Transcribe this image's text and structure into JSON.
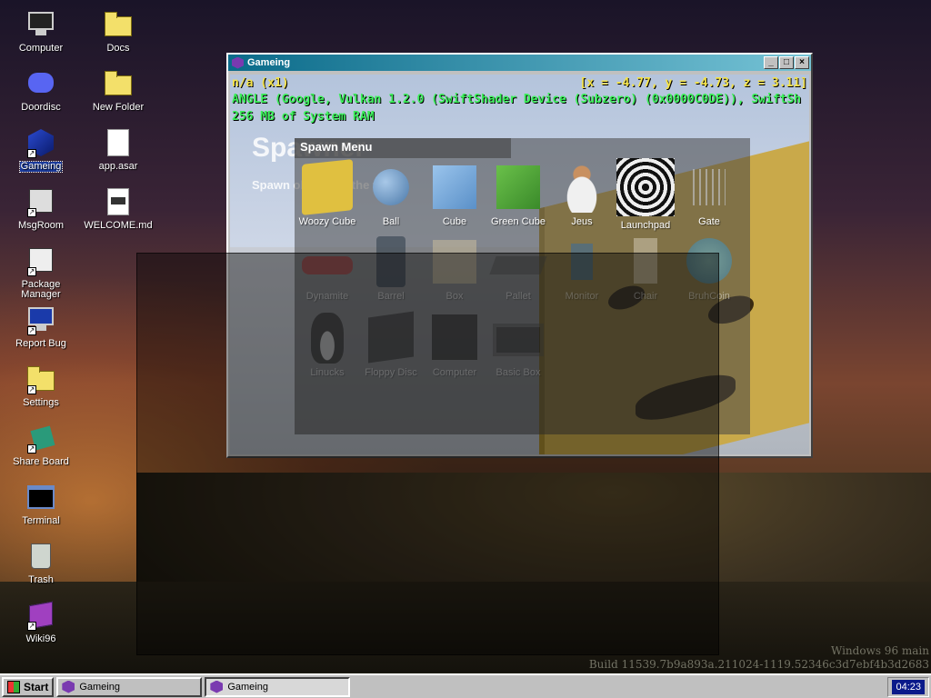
{
  "desktop": {
    "icons_col1": [
      {
        "label": "Computer",
        "icon": "computer-icon"
      },
      {
        "label": "Doordisc",
        "icon": "discord-icon"
      },
      {
        "label": "Gameing",
        "icon": "gameing-icon",
        "selected": true
      },
      {
        "label": "MsgRoom",
        "icon": "msgroom-icon"
      },
      {
        "label": "Package Manager",
        "icon": "package-manager-icon"
      },
      {
        "label": "Report Bug",
        "icon": "report-bug-icon"
      },
      {
        "label": "Settings",
        "icon": "settings-icon"
      },
      {
        "label": "Share Board",
        "icon": "share-board-icon"
      },
      {
        "label": "Terminal",
        "icon": "terminal-icon"
      },
      {
        "label": "Trash",
        "icon": "trash-icon"
      },
      {
        "label": "Wiki96",
        "icon": "wiki-icon"
      }
    ],
    "icons_col2": [
      {
        "label": "Docs",
        "icon": "folder-icon"
      },
      {
        "label": "New Folder",
        "icon": "folder-icon"
      },
      {
        "label": "app.asar",
        "icon": "file-icon"
      },
      {
        "label": "WELCOME.md",
        "icon": "markdown-file-icon"
      }
    ],
    "watermark_line1": "Windows 96 main",
    "watermark_line2": "Build 11539.7b9a893a.211024-1119.52346c3d7ebf4b3d2683"
  },
  "window": {
    "title": "Gameing",
    "controls": [
      "_",
      "□",
      "×"
    ],
    "debug": {
      "line1_left": "n/a (x1)",
      "line1_right": "[x = -4.77, y = -4.73, z = 3.11]",
      "line2": "ANGLE (Google, Vulkan 1.2.0 (SwiftShader Device (Subzero) (0x0000C0DE)), SwiftSh",
      "line3": "256 MB of System RAM"
    },
    "spawner_title": "Spawner",
    "spawner_subtitle": "Spawn objects in the world.",
    "spawn_menu": {
      "title": "Spawn Menu",
      "items": [
        "Woozy Cube",
        "Ball",
        "Cube",
        "Green Cube",
        "Jeus",
        "Launchpad",
        "Gate",
        "Dynamite",
        "Barrel",
        "Box",
        "Pallet",
        "Monitor",
        "Chair",
        "BruhCoin",
        "Linucks",
        "Floppy Disc",
        "Computer",
        "Basic Box"
      ]
    }
  },
  "taskbar": {
    "start_label": "Start",
    "tasks": [
      {
        "label": "Gameing",
        "active": false
      },
      {
        "label": "Gameing",
        "active": true
      }
    ],
    "clock": "04:23"
  }
}
